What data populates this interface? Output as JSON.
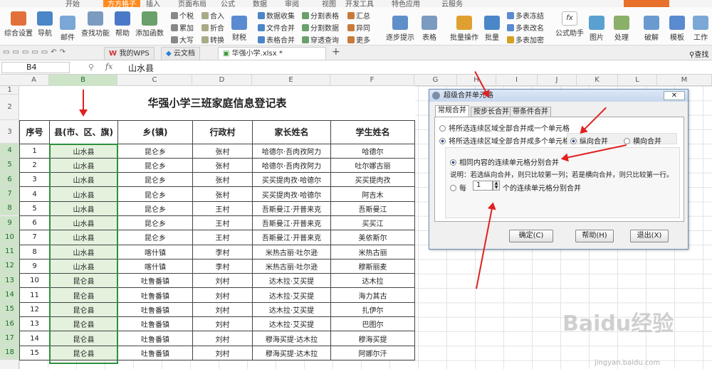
{
  "ribbon_tabs": [
    "开始",
    "插入",
    "页面布局",
    "公式",
    "数据",
    "审阅",
    "视图",
    "开发工具",
    "特色应用",
    "云服务"
  ],
  "ribbon_active": "方方格子",
  "ribbon": {
    "big": [
      "综合设置",
      "导航",
      "邮件",
      "查找功能",
      "帮助",
      "添加函数",
      "财税",
      "逐步提示",
      "表格",
      "批量操作",
      "批量",
      "公式助手",
      "图片",
      "处理",
      "破解",
      "模板",
      "工作"
    ],
    "small": [
      "个税",
      "累加",
      "大写",
      "合入",
      "折合",
      "转换",
      "数据收集",
      "文件合并",
      "表格合并",
      "分割表格",
      "分割数据",
      "穿透查询",
      "汇总",
      "异同",
      "更多",
      "多表冻结",
      "多表改名",
      "多表加密"
    ]
  },
  "doc_tabs": [
    "我的WPS",
    "云文档",
    "华强小学.xlsx *"
  ],
  "right_search": "查找",
  "name_box": "B4",
  "fx_label": "fx",
  "formula_value": "山水县",
  "columns": [
    "A",
    "B",
    "C",
    "D",
    "E",
    "F",
    "G",
    "H",
    "I",
    "J",
    "K",
    "L",
    "M"
  ],
  "rows": [
    "1",
    "2",
    "3",
    "4",
    "5",
    "6",
    "7",
    "8",
    "9",
    "10",
    "11",
    "12",
    "13",
    "14",
    "15",
    "16",
    "17",
    "18"
  ],
  "sheet": {
    "title": "华强小学三班家庭信息登记表",
    "headers": [
      "序号",
      "县(市、区、旗)",
      "乡(镇)",
      "行政村",
      "家长姓名",
      "学生姓名"
    ],
    "data": [
      [
        "1",
        "山水县",
        "昆仑乡",
        "张村",
        "哈德尔·吾肉孜阿力",
        "哈德尔"
      ],
      [
        "2",
        "山水县",
        "昆仑乡",
        "张村",
        "哈德尔·吾肉孜阿力",
        "吐尔娜古丽"
      ],
      [
        "3",
        "山水县",
        "昆仑乡",
        "张村",
        "买买提肉孜·哈德尔",
        "买买提肉孜"
      ],
      [
        "4",
        "山水县",
        "昆仑乡",
        "张村",
        "买买提肉孜·哈德尔",
        "阿吉木"
      ],
      [
        "5",
        "山水县",
        "昆仑乡",
        "王村",
        "吾斯曼江·开普来克",
        "吾斯曼江"
      ],
      [
        "6",
        "山水县",
        "昆仑乡",
        "王村",
        "吾斯曼江·开普来克",
        "买买江"
      ],
      [
        "7",
        "山水县",
        "昆仑乡",
        "王村",
        "吾斯曼江·开普来克",
        "美依斯尔"
      ],
      [
        "8",
        "山水县",
        "喀什镇",
        "李村",
        "米热古丽·吐尔逊",
        "米热古丽"
      ],
      [
        "9",
        "山水县",
        "喀什镇",
        "李村",
        "米热古丽·吐尔逊",
        "穆斯丽麦"
      ],
      [
        "10",
        "昆仑县",
        "吐鲁番镇",
        "刘村",
        "达木拉·艾买提",
        "达木拉"
      ],
      [
        "11",
        "昆仑县",
        "吐鲁番镇",
        "刘村",
        "达木拉·艾买提",
        "海力其古"
      ],
      [
        "12",
        "昆仑县",
        "吐鲁番镇",
        "刘村",
        "达木拉·艾买提",
        "扎伊尔"
      ],
      [
        "13",
        "昆仑县",
        "吐鲁番镇",
        "刘村",
        "达木拉·艾买提",
        "巴图尔"
      ],
      [
        "14",
        "昆仑县",
        "吐鲁番镇",
        "刘村",
        "穆海买提·达木拉",
        "穆海买提"
      ],
      [
        "15",
        "昆仑县",
        "吐鲁番镇",
        "刘村",
        "穆海买提·达木拉",
        "阿娜尔汗"
      ]
    ]
  },
  "dialog": {
    "title": "超级合并单元格",
    "close": "✕",
    "tabs": [
      "常规合并",
      "按步长合并",
      "带条件合并"
    ],
    "opt_one": "将所选连续区域全部合并成一个单元格",
    "opt_multi": "将所选连续区域全部合并成多个单元格",
    "opt_vertical": "纵向合并",
    "opt_horizontal": "横向合并",
    "opt_same": "相同内容的连续单元格分别合并",
    "note": "说明：若选纵向合并，则只比较第一列；若是横向合并，则只比较第一行。",
    "every_prefix": "每",
    "every_value": "1",
    "every_suffix": "个的连续单元格分别合并",
    "ok": "确定(C)",
    "help": "帮助(H)",
    "exit": "退出(X)"
  },
  "watermark": "Baidu经验",
  "watermark_url": "jingyan.baidu.com",
  "colors": {
    "accent": "#ff8a1f",
    "selection": "#cde4c8",
    "arrow": "#e02020"
  }
}
